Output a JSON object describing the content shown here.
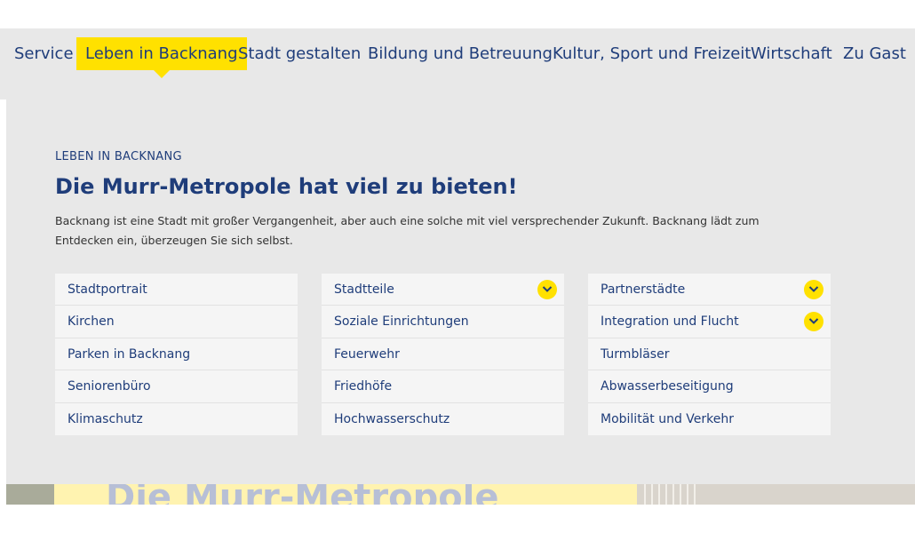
{
  "nav": {
    "items": [
      {
        "label": "Service",
        "active": false
      },
      {
        "label": "Leben in Backnang",
        "active": true
      },
      {
        "label": "Stadt gestalten",
        "active": false
      },
      {
        "label": "Bildung und Betreuung",
        "active": false
      },
      {
        "label": "Kultur, Sport und Freizeit",
        "active": false
      },
      {
        "label": "Wirtschaft",
        "active": false
      },
      {
        "label": "Zu Gast",
        "active": false
      }
    ]
  },
  "intro": {
    "eyebrow": "LEBEN IN BACKNANG",
    "headline": "Die Murr-Metropole hat viel zu bieten!",
    "lead": "Backnang ist eine Stadt mit großer Vergangenheit, aber auch eine solche mit viel versprechender Zukunft. Backnang lädt zum Entdecken ein, überzeugen Sie sich selbst."
  },
  "links": {
    "col1": [
      {
        "label": "Stadtportrait",
        "expandable": false
      },
      {
        "label": "Kirchen",
        "expandable": false
      },
      {
        "label": "Parken in Backnang",
        "expandable": false
      },
      {
        "label": "Seniorenbüro",
        "expandable": false
      },
      {
        "label": "Klimaschutz",
        "expandable": false
      }
    ],
    "col2": [
      {
        "label": "Stadtteile",
        "expandable": true
      },
      {
        "label": "Soziale Einrichtungen",
        "expandable": false
      },
      {
        "label": "Feuerwehr",
        "expandable": false
      },
      {
        "label": "Friedhöfe",
        "expandable": false
      },
      {
        "label": "Hochwasserschutz",
        "expandable": false
      }
    ],
    "col3": [
      {
        "label": "Partnerstädte",
        "expandable": true
      },
      {
        "label": "Integration und Flucht",
        "expandable": true
      },
      {
        "label": "Turmbläser",
        "expandable": false
      },
      {
        "label": "Abwasserbeseitigung",
        "expandable": false
      },
      {
        "label": "Mobilität und Verkehr",
        "expandable": false
      }
    ]
  },
  "hero": {
    "title": "Die Murr-Metropole"
  },
  "colors": {
    "brand_blue": "#1f3d7a",
    "accent_yellow": "#ffe100",
    "panel_gray": "#e8e8e8"
  }
}
